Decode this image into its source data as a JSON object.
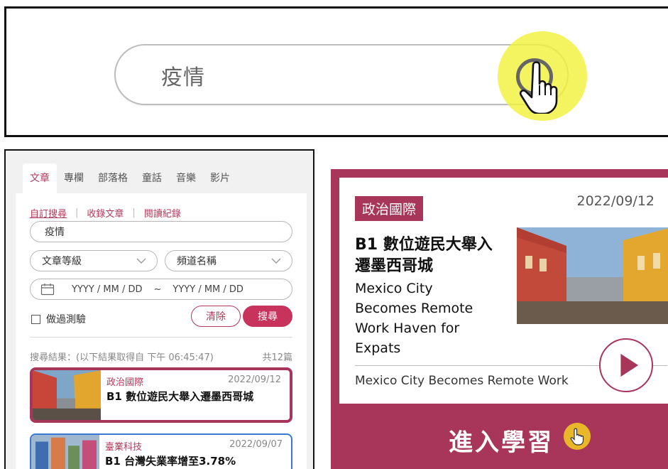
{
  "zoom": {
    "search_value": "疫情"
  },
  "app": {
    "tabs": [
      {
        "label": "文章",
        "active": true
      },
      {
        "label": "專欄",
        "active": false
      },
      {
        "label": "部落格",
        "active": false
      },
      {
        "label": "童話",
        "active": false
      },
      {
        "label": "音樂",
        "active": false
      },
      {
        "label": "影片",
        "active": false
      }
    ],
    "links": [
      "自訂搜尋",
      "收錄文章",
      "閱讀紀錄"
    ],
    "search_value": "疫情",
    "level_select": "文章等級",
    "channel_select": "頻道名稱",
    "date_from": "YYYY / MM / DD",
    "date_sep": "~",
    "date_to": "YYYY / MM / DD",
    "quiz_label": "做過測驗",
    "clear_label": "清除",
    "search_label": "搜尋",
    "result_info": "搜尋結果：(以下結果取得自 下午 06:45:47)",
    "result_count": "共12篇",
    "results": [
      {
        "category": "政治國際",
        "date": "2022/09/12",
        "title": "B1  數位遊民大舉入遷墨西哥城"
      },
      {
        "category": "臺業科技",
        "date": "2022/09/07",
        "title": "B1  台灣失業率增至3.78%"
      }
    ]
  },
  "preview": {
    "category": "政治國際",
    "date": "2022/09/12",
    "title_zh": "B1  數位遊民大舉入遷墨西哥城",
    "title_en": "Mexico City Becomes Remote Work Haven for Expats",
    "subtitle": "Mexico City Becomes Remote Work",
    "enter_label": "進入學習"
  },
  "colors": {
    "accent": "#a8365a",
    "highlight": "#f0f23c",
    "link_blue": "#3b78d6"
  },
  "icons": [
    "search-icon",
    "hand-cursor-icon",
    "chevron-down-icon",
    "calendar-icon",
    "play-icon"
  ]
}
